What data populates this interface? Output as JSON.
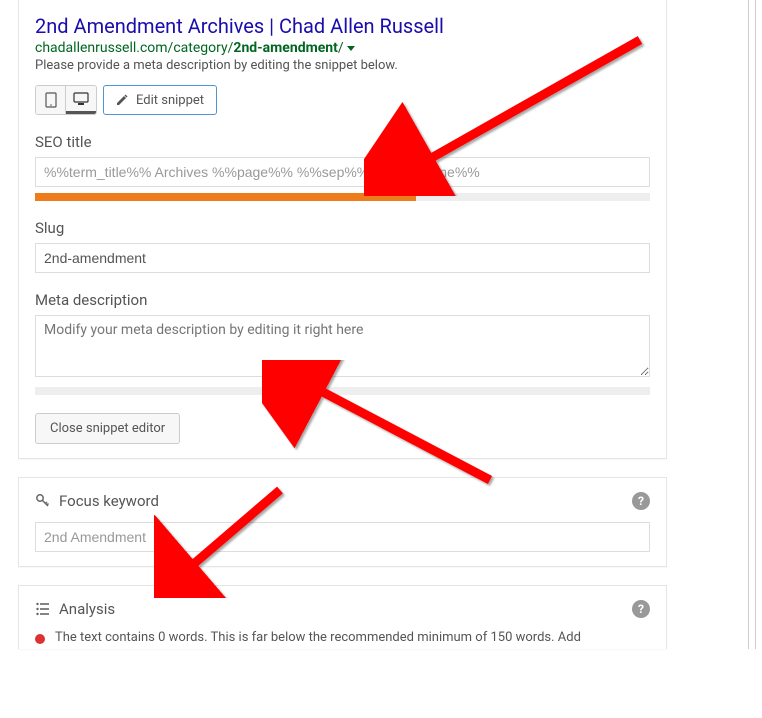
{
  "serp": {
    "title": "2nd Amendment Archives | Chad Allen Russell",
    "url_prefix": "chadallenrussell.com/category/",
    "url_bold": "2nd-amendment",
    "url_suffix": "/",
    "description": "Please provide a meta description by editing the snippet below."
  },
  "buttons": {
    "edit_snippet": "Edit snippet",
    "close_snippet": "Close snippet editor"
  },
  "fields": {
    "seo_title_label": "SEO title",
    "seo_title_value": "%%term_title%% Archives %%page%% %%sep%% %%sitename%%",
    "seo_title_progress": 62,
    "slug_label": "Slug",
    "slug_value": "2nd-amendment",
    "meta_label": "Meta description",
    "meta_placeholder": "Modify your meta description by editing it right here"
  },
  "focus": {
    "label": "Focus keyword",
    "value": "2nd Amendment"
  },
  "analysis": {
    "label": "Analysis",
    "item1": "The text contains 0 words. This is far below the recommended minimum of 150 words. Add"
  }
}
